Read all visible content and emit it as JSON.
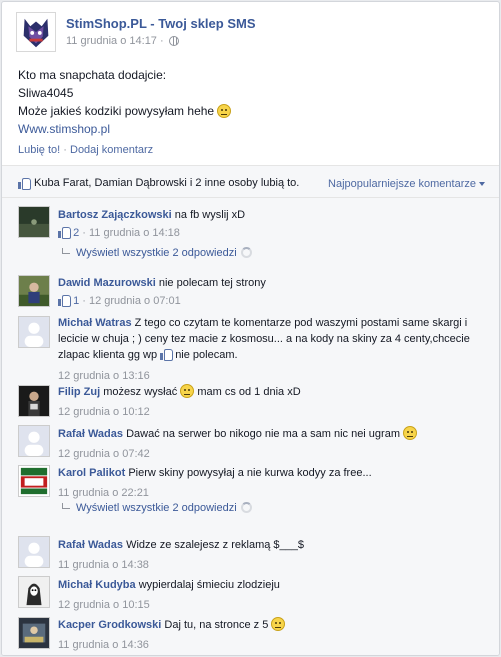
{
  "post": {
    "page_name": "StimShop.PL - Twoj sklep SMS",
    "timestamp": "11 grudnia o 14:17",
    "meta_sep": "·",
    "lines": [
      "Kto ma snapchata dodajcie:",
      "Sliwa4045",
      "Może jakieś kodziki powysyłam hehe"
    ],
    "link": "Www.stimshop.pl",
    "like_action": "Lubię to!",
    "action_sep": "·",
    "comment_action": "Dodaj komentarz"
  },
  "likes_bar": {
    "text": "Kuba Farat, Damian Dąbrowski i 2 inne osoby lubią to.",
    "sort_label": "Najpopularniejsze komentarze"
  },
  "comments": [
    {
      "author": "Bartosz Zajączkowski",
      "text": "na fb wyslij xD",
      "likes": "2",
      "sep": "·",
      "time": "11 grudnia o 14:18",
      "replies": "Wyświetl wszystkie 2 odpowiedzi"
    },
    {
      "author": "Dawid Mazurowski",
      "text": "nie polecam tej strony",
      "likes": "1",
      "sep": "·",
      "time": "12 grudnia o 07:01"
    },
    {
      "author": "Michał Watras",
      "text": "Z tego co czytam te komentarze pod waszymi postami same skargi i lecicie w chuja ; ) ceny tez macie z kosmosu... a na kody na skiny za 4 centy,chcecie zlapac klienta gg wp",
      "text_after": "nie polecam.",
      "time": "12 grudnia o 13:16"
    },
    {
      "author": "Filip Zuj",
      "text": "możesz wysłać",
      "text_after": "mam cs od 1 dnia xD",
      "time": "12 grudnia o 10:12"
    },
    {
      "author": "Rafał Wadas",
      "text": "Dawać na serwer bo nikogo nie ma a sam nic nei ugram",
      "time": "12 grudnia o 07:42"
    },
    {
      "author": "Karol Palikot",
      "text": "Pierw skiny powysyłaj a nie kurwa kodyy za free...",
      "time": "11 grudnia o 22:21",
      "replies": "Wyświetl wszystkie 2 odpowiedzi"
    },
    {
      "author": "Rafał Wadas",
      "text": "Widze ze szalejesz z reklamą $___$",
      "time": "11 grudnia o 14:38"
    },
    {
      "author": "Michał Kudyba",
      "text": "wypierdalaj śmieciu zlodzieju",
      "time": "12 grudnia o 10:15"
    },
    {
      "author": "Kacper Grodkowski",
      "text": "Daj tu, na stronce z 5",
      "time": "11 grudnia o 14:36"
    }
  ],
  "colors": {
    "link": "#3b5998",
    "meta": "#90949c",
    "ufi_bg": "#f6f7f9"
  },
  "icons": [
    "page-logo-icon",
    "globe-icon",
    "smiley-icon",
    "thumb-icon",
    "caret-down-icon",
    "reply-arrow-icon",
    "spinner-icon"
  ]
}
